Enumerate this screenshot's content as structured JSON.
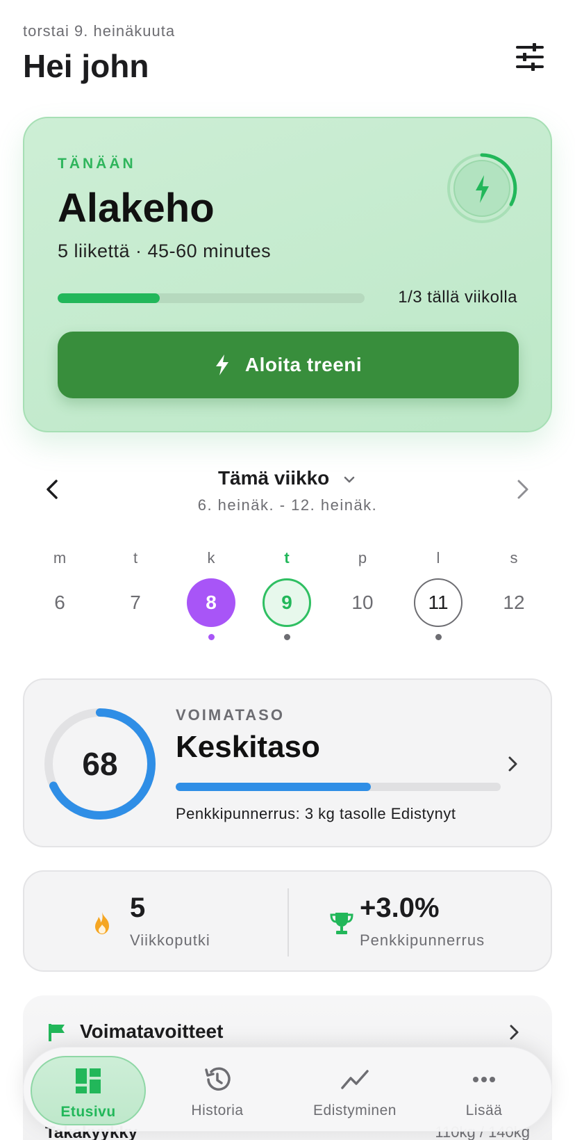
{
  "header": {
    "date": "torstai 9. heinäkuuta",
    "greeting": "Hei john"
  },
  "today": {
    "label": "TÄNÄÄN",
    "title": "Alakeho",
    "subtitle": "5 liikettä · 45-60 minutes",
    "week_progress": 0.333,
    "week_progress_text": "1/3 tällä viikolla",
    "start_label": "Aloita treeni"
  },
  "week": {
    "title": "Tämä viikko",
    "range": "6. heinäk. - 12. heinäk.",
    "days": [
      {
        "letter": "m",
        "num": "6",
        "state": "none"
      },
      {
        "letter": "t",
        "num": "7",
        "state": "none"
      },
      {
        "letter": "k",
        "num": "8",
        "state": "done"
      },
      {
        "letter": "t",
        "num": "9",
        "state": "today"
      },
      {
        "letter": "p",
        "num": "10",
        "state": "none"
      },
      {
        "letter": "l",
        "num": "11",
        "state": "planned"
      },
      {
        "letter": "s",
        "num": "12",
        "state": "none"
      }
    ]
  },
  "strength": {
    "score": "68",
    "score_fraction": 0.68,
    "label": "VOIMATASO",
    "level": "Keskitaso",
    "level_progress": 0.6,
    "note": "Penkkipunnerrus: 3 kg tasolle Edistynyt"
  },
  "stats": {
    "streak_value": "5",
    "streak_label": "Viikkoputki",
    "bench_value": "+3.0%",
    "bench_label": "Penkkipunnerrus"
  },
  "goals": {
    "title": "Voimatavoitteet",
    "peek_left": "Takakyykky",
    "peek_right": "110kg / 140kg"
  },
  "tabs": [
    {
      "label": "Etusivu",
      "icon": "dashboard-icon"
    },
    {
      "label": "Historia",
      "icon": "history-icon"
    },
    {
      "label": "Edistyminen",
      "icon": "trend-icon"
    },
    {
      "label": "Lisää",
      "icon": "more-icon"
    }
  ],
  "colors": {
    "accent_green": "#22b75a",
    "button_green": "#388e3c",
    "done_purple": "#a855f7",
    "strength_blue": "#2f8ee6",
    "streak_orange": "#f5a623"
  }
}
